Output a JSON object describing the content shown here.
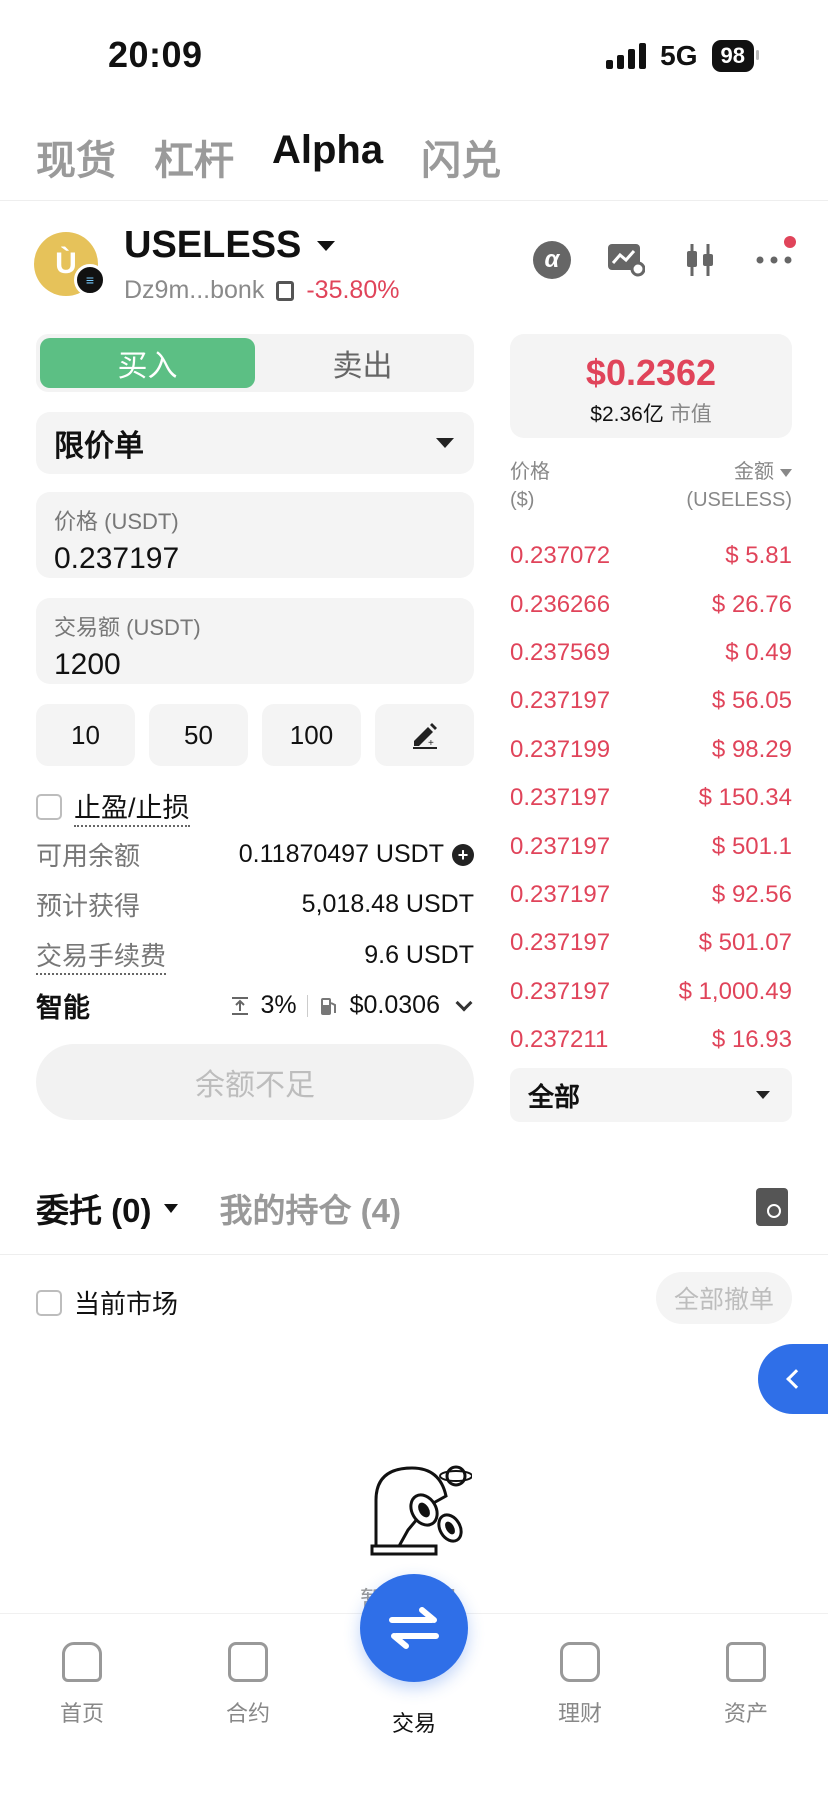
{
  "status_bar": {
    "time": "20:09",
    "network": "5G",
    "battery": "98"
  },
  "top_tabs": [
    "现货",
    "杠杆",
    "Alpha",
    "闪兑"
  ],
  "token": {
    "name": "USELESS",
    "address": "Dz9m...bonk",
    "change": "-35.80%"
  },
  "order_side": {
    "buy": "买入",
    "sell": "卖出"
  },
  "order_type": "限价单",
  "price_field": {
    "label": "价格 (USDT)",
    "value": "0.237197"
  },
  "amount_field": {
    "label": "交易额 (USDT)",
    "value": "1200"
  },
  "quick_amounts": [
    "10",
    "50",
    "100"
  ],
  "tp_sl_label": "止盈/止损",
  "info": {
    "available_label": "可用余额",
    "available_value": "0.11870497 USDT",
    "estimated_label": "预计获得",
    "estimated_value": "5,018.48 USDT",
    "fee_label": "交易手续费",
    "fee_value": "9.6 USDT",
    "smart_label": "智能",
    "slippage": "3%",
    "gas": "$0.0306"
  },
  "submit_label": "余额不足",
  "price_card": {
    "price": "$0.2362",
    "market_cap": "$2.36亿",
    "market_cap_label": "市值"
  },
  "orderbook": {
    "price_header": "价格",
    "price_unit": "($)",
    "amount_header": "金额",
    "amount_unit": "(USELESS)",
    "rows": [
      {
        "price": "0.237072",
        "amount": "$ 5.81"
      },
      {
        "price": "0.236266",
        "amount": "$ 26.76"
      },
      {
        "price": "0.237569",
        "amount": "$ 0.49"
      },
      {
        "price": "0.237197",
        "amount": "$ 56.05"
      },
      {
        "price": "0.237199",
        "amount": "$ 98.29"
      },
      {
        "price": "0.237197",
        "amount": "$ 150.34"
      },
      {
        "price": "0.237197",
        "amount": "$ 501.1"
      },
      {
        "price": "0.237197",
        "amount": "$ 92.56"
      },
      {
        "price": "0.237197",
        "amount": "$ 501.07"
      },
      {
        "price": "0.237197",
        "amount": "$ 1,000.49"
      },
      {
        "price": "0.237211",
        "amount": "$ 16.93"
      }
    ],
    "filter": "全部"
  },
  "bottom_tabs": {
    "orders": "委托 (0)",
    "positions": "我的持仓 (4)"
  },
  "current_market_label": "当前市场",
  "cancel_all_label": "全部撤单",
  "empty_text": "暂无数据",
  "nav": [
    "首页",
    "合约",
    "交易",
    "理财",
    "资产"
  ],
  "colors": {
    "buy": "#5cbf84",
    "down": "#e0445a",
    "primary": "#2f6fe8"
  }
}
